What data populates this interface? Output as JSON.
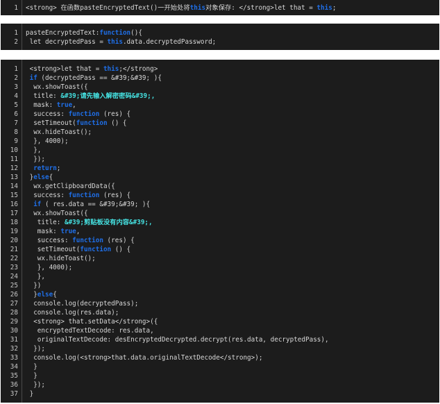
{
  "blocks": [
    {
      "lines": [
        [
          {
            "t": "<strong> 在函数pasteEncryptedText()一开始处将"
          },
          {
            "t": "this",
            "c": "kw"
          },
          {
            "t": "对象保存: </strong>let that = "
          },
          {
            "t": "this",
            "c": "kw"
          },
          {
            "t": ";"
          }
        ]
      ]
    },
    {
      "lines": [
        [
          {
            "t": "pasteEncryptedText:"
          },
          {
            "t": "function",
            "c": "kw"
          },
          {
            "t": "(){"
          }
        ],
        [
          {
            "t": " let decryptedPass = "
          },
          {
            "t": "this",
            "c": "kw"
          },
          {
            "t": ".data.decryptedPassword;"
          }
        ]
      ]
    },
    {
      "lines": [
        [
          {
            "t": " <strong>let that = "
          },
          {
            "t": "this",
            "c": "kw"
          },
          {
            "t": ";</strong>"
          }
        ],
        [
          {
            "t": " "
          },
          {
            "t": "if",
            "c": "kw"
          },
          {
            "t": " (decryptedPass == &#39;&#39; ){"
          }
        ],
        [
          {
            "t": "  wx.showToast({"
          }
        ],
        [
          {
            "t": "  title: "
          },
          {
            "t": "&#39;请先输入解密密码&#39;,",
            "c": "st"
          }
        ],
        [
          {
            "t": "  mask: "
          },
          {
            "t": "true",
            "c": "kw"
          },
          {
            "t": ","
          }
        ],
        [
          {
            "t": "  success: "
          },
          {
            "t": "function",
            "c": "kw"
          },
          {
            "t": " (res) {"
          }
        ],
        [
          {
            "t": "  setTimeout("
          },
          {
            "t": "function",
            "c": "kw"
          },
          {
            "t": " () {"
          }
        ],
        [
          {
            "t": "  wx.hideToast();"
          }
        ],
        [
          {
            "t": "  }, 4000);"
          }
        ],
        [
          {
            "t": "  },"
          }
        ],
        [
          {
            "t": "  });"
          }
        ],
        [
          {
            "t": "  "
          },
          {
            "t": "return",
            "c": "kw"
          },
          {
            "t": ";"
          }
        ],
        [
          {
            "t": " }"
          },
          {
            "t": "else",
            "c": "kw"
          },
          {
            "t": "{"
          }
        ],
        [
          {
            "t": "  wx.getClipboardData({"
          }
        ],
        [
          {
            "t": "  success: "
          },
          {
            "t": "function",
            "c": "kw"
          },
          {
            "t": " (res) {"
          }
        ],
        [
          {
            "t": "  "
          },
          {
            "t": "if",
            "c": "kw"
          },
          {
            "t": " ( res.data == &#39;&#39; ){"
          }
        ],
        [
          {
            "t": "  wx.showToast({"
          }
        ],
        [
          {
            "t": "   title: "
          },
          {
            "t": "&#39;剪贴板没有内容&#39;,",
            "c": "st"
          }
        ],
        [
          {
            "t": "   mask: "
          },
          {
            "t": "true",
            "c": "kw"
          },
          {
            "t": ","
          }
        ],
        [
          {
            "t": "   success: "
          },
          {
            "t": "function",
            "c": "kw"
          },
          {
            "t": " (res) {"
          }
        ],
        [
          {
            "t": "   setTimeout("
          },
          {
            "t": "function",
            "c": "kw"
          },
          {
            "t": " () {"
          }
        ],
        [
          {
            "t": "   wx.hideToast();"
          }
        ],
        [
          {
            "t": "   }, 4000);"
          }
        ],
        [
          {
            "t": "   },"
          }
        ],
        [
          {
            "t": "  })"
          }
        ],
        [
          {
            "t": "  }"
          },
          {
            "t": "else",
            "c": "kw"
          },
          {
            "t": "{"
          }
        ],
        [
          {
            "t": "  console.log(decryptedPass);"
          }
        ],
        [
          {
            "t": "  console.log(res.data);"
          }
        ],
        [
          {
            "t": "  <strong> that.setData</strong>({"
          }
        ],
        [
          {
            "t": "   encryptedTextDecode: res.data,"
          }
        ],
        [
          {
            "t": "   originalTextDecode: desEncryptedDecrypted.decrypt(res.data, decryptedPass),"
          }
        ],
        [
          {
            "t": "  });"
          }
        ],
        [
          {
            "t": "  console.log(<strong>that.data.originalTextDecode</strong>);"
          }
        ],
        [
          {
            "t": "  }"
          }
        ],
        [
          {
            "t": "  }"
          }
        ],
        [
          {
            "t": "  });"
          }
        ],
        [
          {
            "t": " }"
          }
        ]
      ]
    }
  ]
}
